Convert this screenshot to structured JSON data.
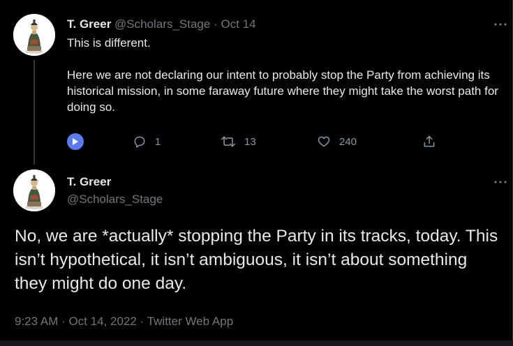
{
  "reply_tweet": {
    "author_name": "T. Greer",
    "author_handle": "@Scholars_Stage",
    "separator": "·",
    "date": "Oct 14",
    "paragraphs": [
      "This is different.",
      "Here we are not declaring our intent to probably stop the Party from achieving its historical mission, in some faraway future where they might take the worst path for doing so."
    ],
    "actions": {
      "play_icon": "play-icon",
      "reply_icon": "reply-icon",
      "reply_count": "1",
      "retweet_icon": "retweet-icon",
      "retweet_count": "13",
      "like_icon": "heart-icon",
      "like_count": "240",
      "share_icon": "share-icon"
    }
  },
  "main_tweet": {
    "author_name": "T. Greer",
    "author_handle": "@Scholars_Stage",
    "text": "No, we are *actually* stopping the Party in its tracks, today. This isn’t hypothetical, it isn’t ambiguous, it isn’t  about something they might do one day.",
    "time": "9:23 AM",
    "separator": "·",
    "date": "Oct 14, 2022",
    "source_app": "Twitter Web App"
  },
  "colors": {
    "background": "#000000",
    "text_primary": "#e7e9ea",
    "text_muted": "#71767b",
    "action_icons": "#8b98a5",
    "play_button": "#5b7cf0",
    "thread_line": "#333639"
  }
}
